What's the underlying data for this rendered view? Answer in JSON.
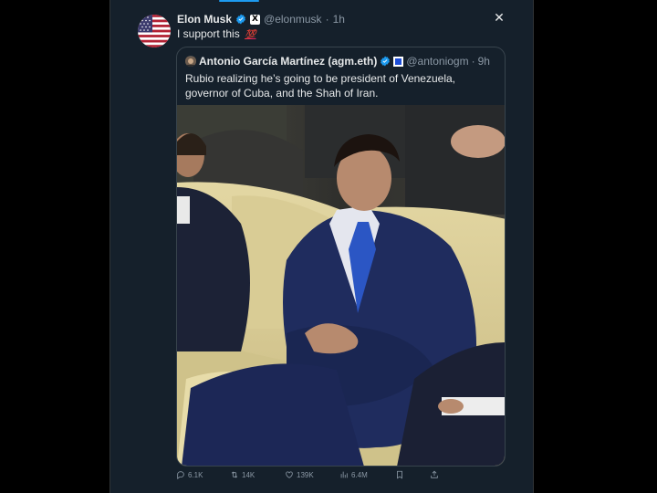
{
  "post": {
    "author_name": "Elon Musk",
    "handle": "@elonmusk",
    "separator": "·",
    "time": "1h",
    "text": "I support this",
    "emoji": "💯",
    "affiliate_badge": "X",
    "close_icon": "close-icon",
    "verified_color": "#1d9bf0"
  },
  "quote": {
    "author_name": "Antonio García Martínez (agm.eth)",
    "handle": "@antoniogm",
    "separator": "·",
    "time": "9h",
    "text": "Rubio realizing he’s going to be president of Venezuela, governor of Cuba, and the Shah of Iran."
  },
  "actions": [
    {
      "name": "reply",
      "icon": "reply-icon",
      "count": "6.1K"
    },
    {
      "name": "repost",
      "icon": "repost-icon",
      "count": "14K"
    },
    {
      "name": "like",
      "icon": "heart-icon",
      "count": "139K"
    },
    {
      "name": "views",
      "icon": "views-icon",
      "count": "6.4M"
    },
    {
      "name": "bookmark",
      "icon": "bookmark-icon",
      "count": ""
    },
    {
      "name": "share",
      "icon": "share-icon",
      "count": ""
    }
  ],
  "colors": {
    "background": "#15202b",
    "border": "#38444d",
    "text": "#e7e9ea",
    "muted": "#8b98a5",
    "accent": "#1d9bf0"
  }
}
